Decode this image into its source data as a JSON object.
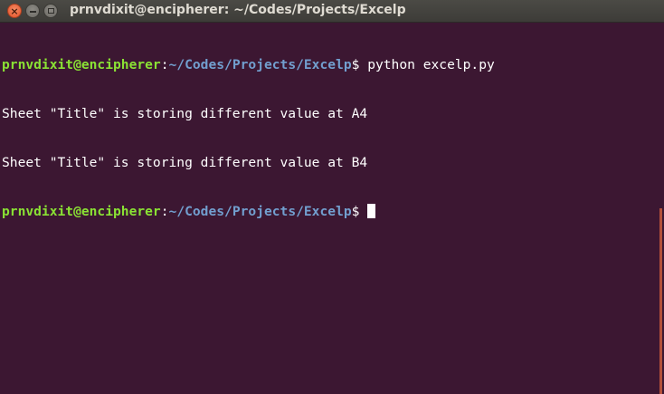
{
  "window": {
    "title": "prnvdixit@encipherer: ~/Codes/Projects/Excelp",
    "colors": {
      "background": "#3c1732",
      "user_host": "#8ae234",
      "path": "#729fcf",
      "text": "#ffffff",
      "scroll_thumb": "#b4513b"
    }
  },
  "terminal": {
    "prompt1": {
      "user_host": "prnvdixit@encipherer",
      "sep": ":",
      "path": "~/Codes/Projects/Excelp",
      "dollar": "$ ",
      "command": "python excelp.py"
    },
    "output": [
      "Sheet \"Title\" is storing different value at A4",
      "Sheet \"Title\" is storing different value at B4"
    ],
    "prompt2": {
      "user_host": "prnvdixit@encipherer",
      "sep": ":",
      "path": "~/Codes/Projects/Excelp",
      "dollar": "$ "
    }
  }
}
